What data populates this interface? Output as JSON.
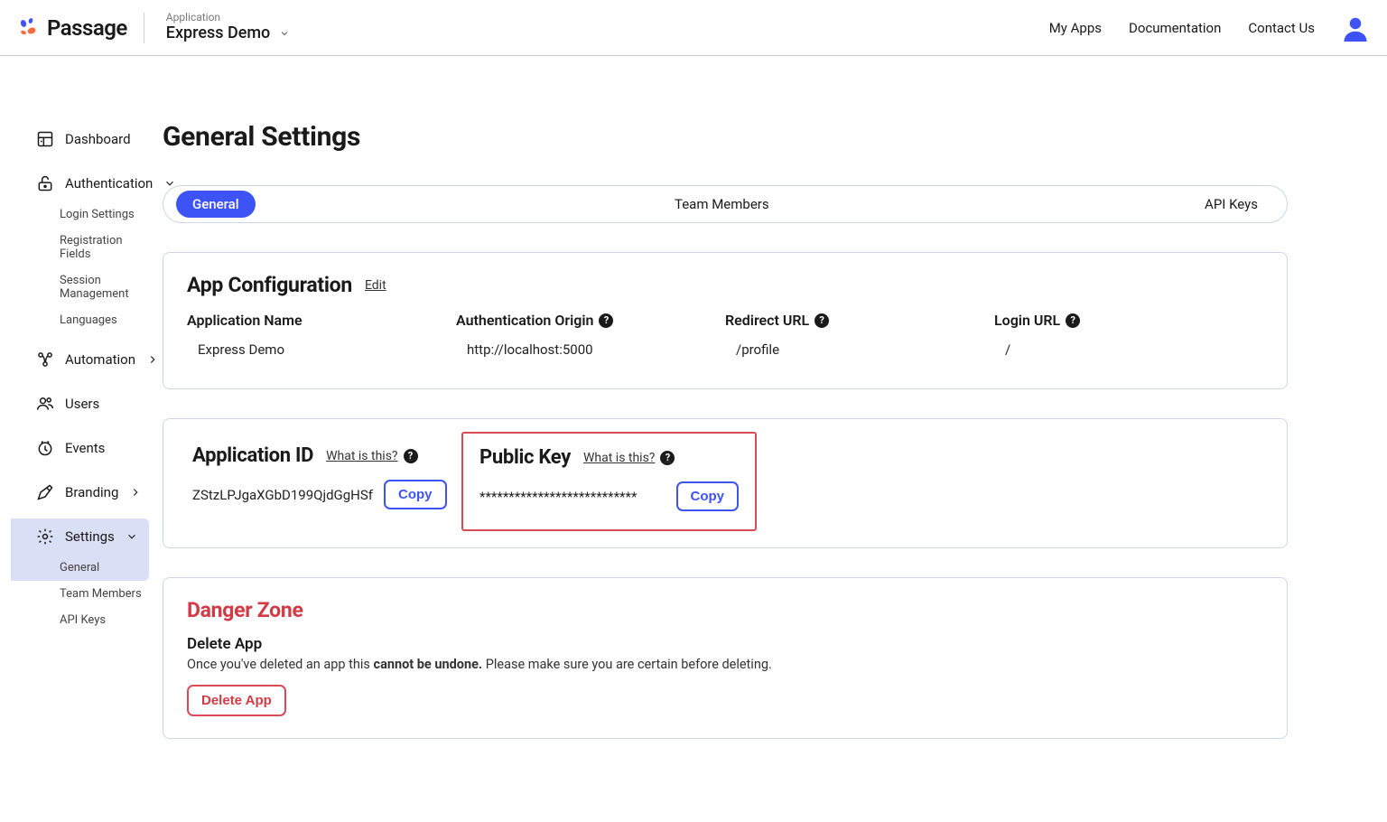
{
  "header": {
    "brand": "Passage",
    "picker_label": "Application",
    "picker_value": "Express Demo",
    "links": {
      "myapps": "My Apps",
      "docs": "Documentation",
      "contact": "Contact Us"
    }
  },
  "sidebar": {
    "dashboard": "Dashboard",
    "auth": "Authentication",
    "auth_children": {
      "login": "Login Settings",
      "registration": "Registration Fields",
      "session": "Session Management",
      "languages": "Languages"
    },
    "automation": "Automation",
    "users": "Users",
    "events": "Events",
    "branding": "Branding",
    "settings": "Settings",
    "settings_children": {
      "general": "General",
      "team": "Team Members",
      "apikeys": "API Keys"
    }
  },
  "page": {
    "title": "General Settings"
  },
  "tabs": {
    "general": "General",
    "team": "Team Members",
    "apikeys": "API Keys"
  },
  "appconfig": {
    "title": "App Configuration",
    "edit": "Edit",
    "fields": {
      "appname": {
        "label": "Application Name",
        "value": "Express Demo"
      },
      "origin": {
        "label": "Authentication Origin",
        "value": "http://localhost:5000"
      },
      "redirect": {
        "label": "Redirect URL",
        "value": "/profile"
      },
      "login": {
        "label": "Login URL",
        "value": "/"
      }
    }
  },
  "idpk": {
    "appid_title": "Application ID",
    "appid_value": "ZStzLPJgaXGbD199QjdGgHSf",
    "pk_title": "Public Key",
    "pk_value": "***************************",
    "what": "What is this?",
    "copy": "Copy"
  },
  "danger": {
    "title": "Danger Zone",
    "subtitle": "Delete App",
    "text_pre": "Once you've deleted an app this ",
    "text_bold": "cannot be undone.",
    "text_post": " Please make sure you are certain before deleting.",
    "button": "Delete App"
  }
}
